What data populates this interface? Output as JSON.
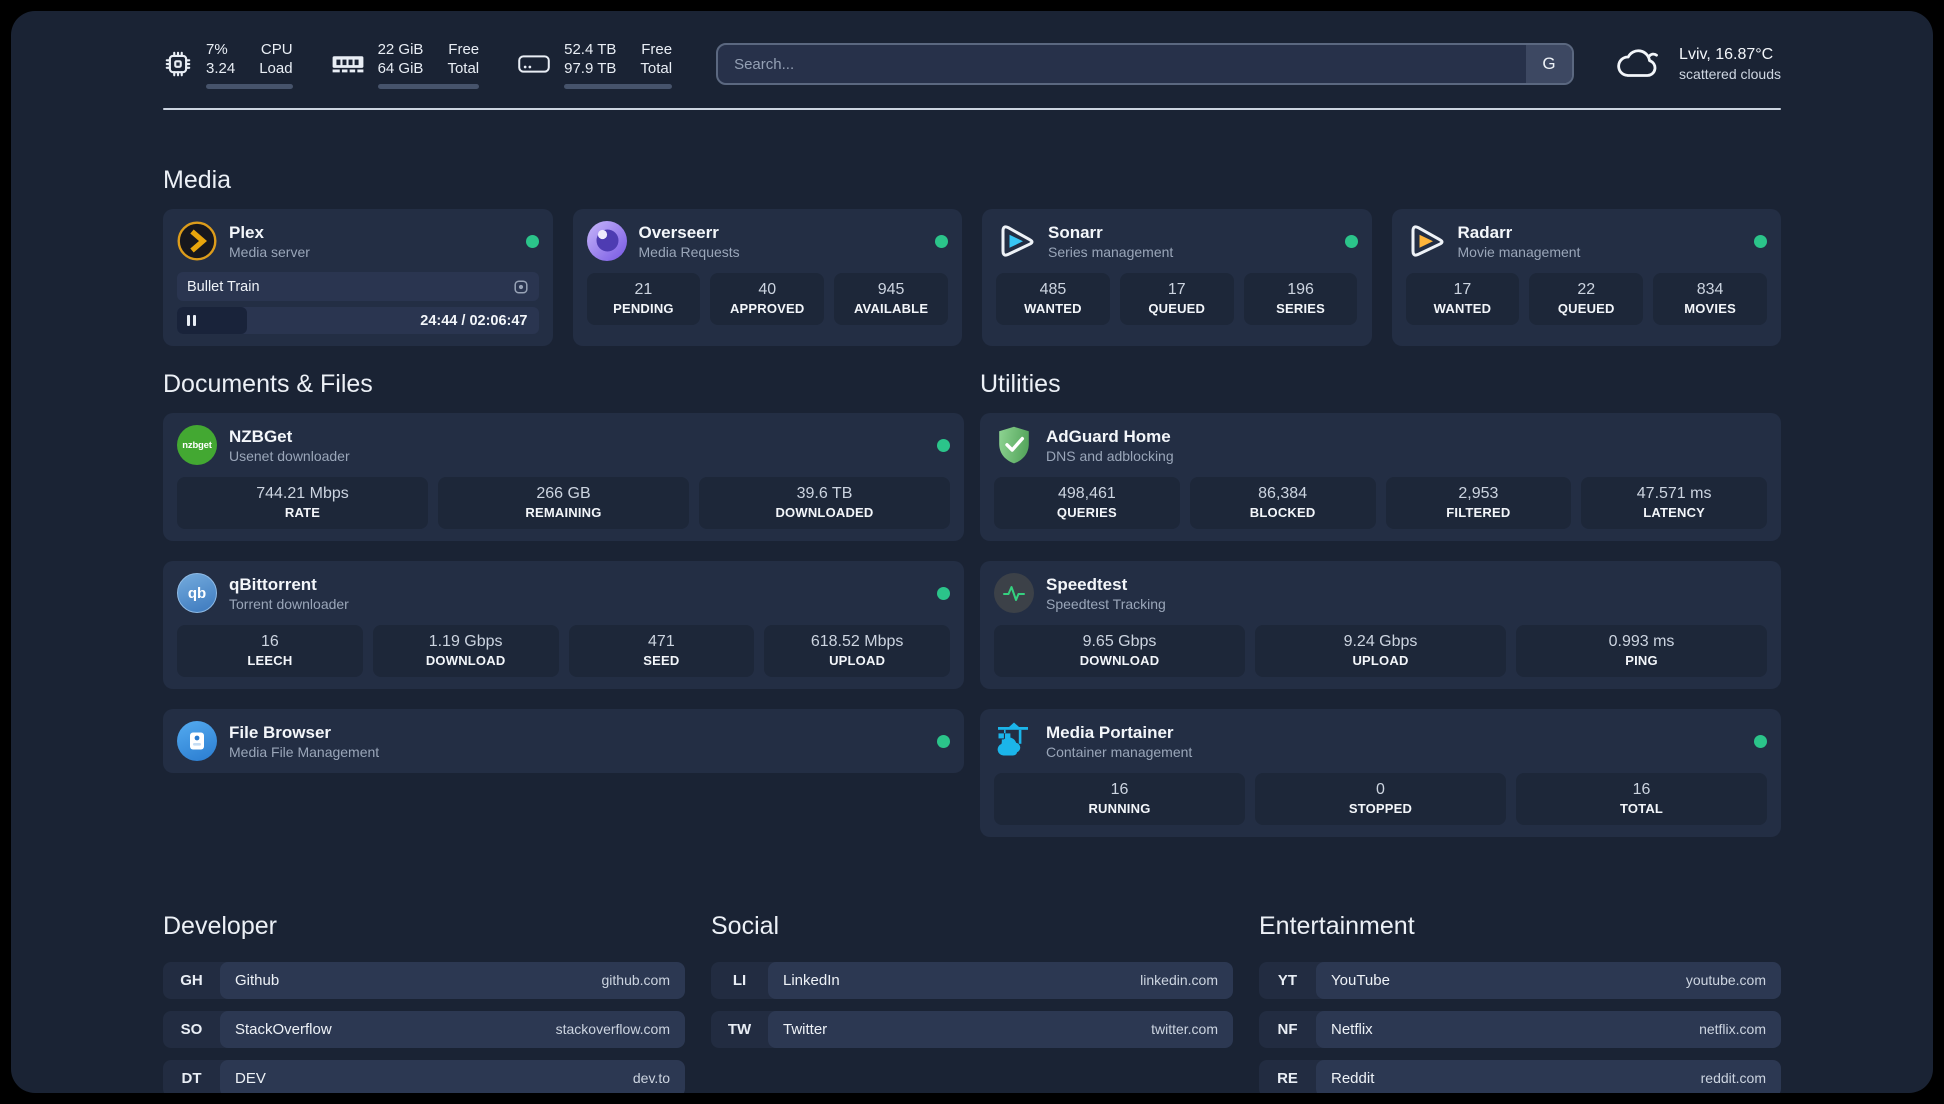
{
  "header": {
    "system_stats": [
      {
        "name": "cpu",
        "values": [
          "7%",
          "3.24"
        ],
        "labels": [
          "CPU",
          "Load"
        ],
        "progress_pct": 8
      },
      {
        "name": "memory",
        "values": [
          "22 GiB",
          "64 GiB"
        ],
        "labels": [
          "Free",
          "Total"
        ],
        "progress_pct": 63
      },
      {
        "name": "storage",
        "values": [
          "52.4 TB",
          "97.9 TB"
        ],
        "labels": [
          "Free",
          "Total"
        ],
        "progress_pct": 47
      }
    ],
    "search": {
      "placeholder": "Search...",
      "engine_label": "G"
    },
    "weather": {
      "location_temp": "Lviv, 16.87°C",
      "condition": "scattered clouds"
    }
  },
  "media": {
    "heading": "Media",
    "plex": {
      "title": "Plex",
      "subtitle": "Media server",
      "online": true,
      "now_playing": "Bullet Train",
      "time": "24:44 / 02:06:47",
      "progress_pct": 19.5
    },
    "overseerr": {
      "title": "Overseerr",
      "subtitle": "Media Requests",
      "online": true,
      "stats": [
        {
          "value": "21",
          "label": "PENDING"
        },
        {
          "value": "40",
          "label": "APPROVED"
        },
        {
          "value": "945",
          "label": "AVAILABLE"
        }
      ]
    },
    "sonarr": {
      "title": "Sonarr",
      "subtitle": "Series management",
      "online": true,
      "stats": [
        {
          "value": "485",
          "label": "WANTED"
        },
        {
          "value": "17",
          "label": "QUEUED"
        },
        {
          "value": "196",
          "label": "SERIES"
        }
      ]
    },
    "radarr": {
      "title": "Radarr",
      "subtitle": "Movie management",
      "online": true,
      "stats": [
        {
          "value": "17",
          "label": "WANTED"
        },
        {
          "value": "22",
          "label": "QUEUED"
        },
        {
          "value": "834",
          "label": "MOVIES"
        }
      ]
    }
  },
  "documents": {
    "heading": "Documents & Files",
    "nzbget": {
      "title": "NZBGet",
      "subtitle": "Usenet downloader",
      "icon_text": "nzbget",
      "online": true,
      "stats": [
        {
          "value": "744.21 Mbps",
          "label": "RATE"
        },
        {
          "value": "266 GB",
          "label": "REMAINING"
        },
        {
          "value": "39.6 TB",
          "label": "DOWNLOADED"
        }
      ]
    },
    "qbittorrent": {
      "title": "qBittorrent",
      "subtitle": "Torrent downloader",
      "icon_text": "qb",
      "online": true,
      "stats": [
        {
          "value": "16",
          "label": "LEECH"
        },
        {
          "value": "1.19 Gbps",
          "label": "DOWNLOAD"
        },
        {
          "value": "471",
          "label": "SEED"
        },
        {
          "value": "618.52 Mbps",
          "label": "UPLOAD"
        }
      ]
    },
    "filebrowser": {
      "title": "File Browser",
      "subtitle": "Media File Management",
      "online": true
    }
  },
  "utilities": {
    "heading": "Utilities",
    "adguard": {
      "title": "AdGuard Home",
      "subtitle": "DNS and adblocking",
      "online": false,
      "stats": [
        {
          "value": "498,461",
          "label": "QUERIES"
        },
        {
          "value": "86,384",
          "label": "BLOCKED"
        },
        {
          "value": "2,953",
          "label": "FILTERED"
        },
        {
          "value": "47.571 ms",
          "label": "LATENCY"
        }
      ]
    },
    "speedtest": {
      "title": "Speedtest",
      "subtitle": "Speedtest Tracking",
      "online": false,
      "stats": [
        {
          "value": "9.65 Gbps",
          "label": "DOWNLOAD"
        },
        {
          "value": "9.24 Gbps",
          "label": "UPLOAD"
        },
        {
          "value": "0.993 ms",
          "label": "PING"
        }
      ]
    },
    "portainer": {
      "title": "Media Portainer",
      "subtitle": "Container management",
      "online": true,
      "stats": [
        {
          "value": "16",
          "label": "RUNNING"
        },
        {
          "value": "0",
          "label": "STOPPED"
        },
        {
          "value": "16",
          "label": "TOTAL"
        }
      ]
    }
  },
  "links": {
    "developer": {
      "heading": "Developer",
      "items": [
        {
          "tag": "GH",
          "name": "Github",
          "url": "github.com"
        },
        {
          "tag": "SO",
          "name": "StackOverflow",
          "url": "stackoverflow.com"
        },
        {
          "tag": "DT",
          "name": "DEV",
          "url": "dev.to"
        }
      ]
    },
    "social": {
      "heading": "Social",
      "items": [
        {
          "tag": "LI",
          "name": "LinkedIn",
          "url": "linkedin.com"
        },
        {
          "tag": "TW",
          "name": "Twitter",
          "url": "twitter.com"
        }
      ]
    },
    "entertainment": {
      "heading": "Entertainment",
      "items": [
        {
          "tag": "YT",
          "name": "YouTube",
          "url": "youtube.com"
        },
        {
          "tag": "NF",
          "name": "Netflix",
          "url": "netflix.com"
        },
        {
          "tag": "RE",
          "name": "Reddit",
          "url": "reddit.com"
        }
      ]
    }
  },
  "colors": {
    "status_online": "#2bc48a",
    "plex_gold": "#e8a50c",
    "sonarr_cyan": "#38c6f4",
    "radarr_gold": "#ffb53a",
    "adguard_green": "#68bc71",
    "nzbget_green": "#43a832",
    "qbittorrent_blue": "#4a86c8",
    "filebrowser_blue": "#2f8fdd",
    "portainer_blue": "#1bb5ea",
    "overseerr_purple": "#7a5be0",
    "speedtest_green": "#35d07f"
  }
}
